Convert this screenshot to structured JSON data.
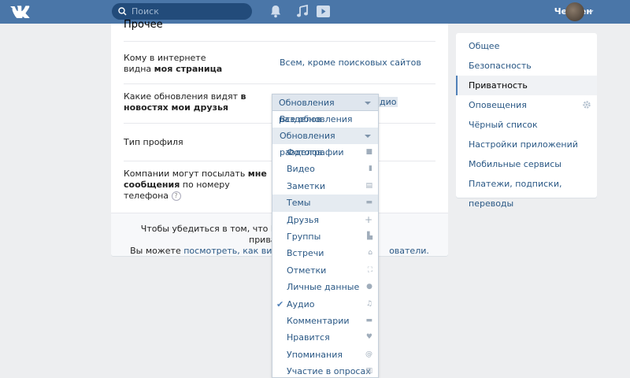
{
  "header": {
    "logo": "VK",
    "search_placeholder": "Поиск",
    "user_name": "Чермен"
  },
  "card": {
    "title": "Прочее",
    "rows": [
      {
        "label_prefix": "Кому в интернете видна ",
        "label_bold": "моя страница",
        "value": "Всем, кроме поисковых сайтов"
      },
      {
        "label_prefix": "Какие обновления видят ",
        "label_bold": "в новостях мои друзья",
        "value": "Обновления разделов"
      },
      {
        "label": "Тип профиля"
      },
      {
        "label_prefix": "Компании могут посылать ",
        "label_bold": "мне сообщения",
        "label_suffix": " по номеру телефона",
        "help": "?"
      }
    ],
    "behind_text": "дио",
    "footer": {
      "line1_start": "Чтобы убедиться в том, что Вы устано",
      "line1_end": " приватности,",
      "line2_start": "Вы можете ",
      "link1": "посмотреть, как видят",
      "line2_end": "ователи."
    }
  },
  "dropdown": {
    "selected": "Обновления разделов",
    "all": "Все обновления",
    "sub": "Обновления разделов",
    "items": [
      {
        "label": "Фотографии",
        "icon": "camera-icon"
      },
      {
        "label": "Видео",
        "icon": "video-icon"
      },
      {
        "label": "Заметки",
        "icon": "notes-icon"
      },
      {
        "label": "Темы",
        "icon": "topic-icon"
      },
      {
        "label": "Друзья",
        "icon": "plus-icon"
      },
      {
        "label": "Группы",
        "icon": "groups-icon"
      },
      {
        "label": "Встречи",
        "icon": "meeting-icon"
      },
      {
        "label": "Отметки",
        "icon": "tag-icon"
      },
      {
        "label": "Личные данные",
        "icon": "person-icon"
      },
      {
        "label": "Аудио",
        "icon": "music-icon",
        "checked": true
      },
      {
        "label": "Комментарии",
        "icon": "comment-icon"
      },
      {
        "label": "Нравится",
        "icon": "heart-icon"
      },
      {
        "label": "Упоминания",
        "icon": "at-icon"
      },
      {
        "label": "Участие в опросах",
        "icon": "poll-icon"
      }
    ]
  },
  "menu": {
    "items": [
      "Общее",
      "Безопасность",
      "Приватность",
      "Оповещения",
      "Чёрный список",
      "Настройки приложений",
      "Мобильные сервисы",
      "Платежи, подписки, переводы"
    ],
    "active_index": 2
  },
  "colors": {
    "header": "#4a76a8",
    "link": "#2a5885",
    "background": "#edeef0"
  }
}
